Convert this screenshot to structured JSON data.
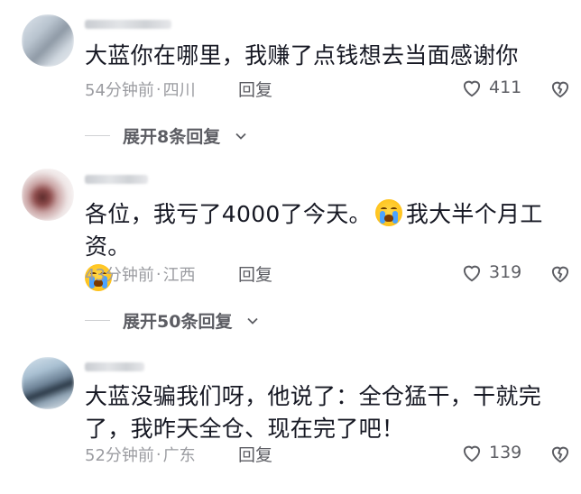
{
  "comments": [
    {
      "username": "•••••",
      "text": "大蓝你在哪里，我赚了点钱想去当面感谢你",
      "time": "54分钟前",
      "location": "四川",
      "reply_label": "回复",
      "likes": "411",
      "expand": "展开8条回复"
    },
    {
      "username": "•••••",
      "text_part1": "各位，我亏了4000了今天。",
      "text_part2": "我大半个月工资。",
      "time": "43分钟前",
      "location": "江西",
      "reply_label": "回复",
      "likes": "319",
      "expand": "展开50条回复"
    },
    {
      "username": "•••••",
      "text": "大蓝没骗我们呀，他说了：全仓猛干，干就完了，我昨天全仓、现在完了吧！",
      "time": "52分钟前",
      "location": "广东",
      "reply_label": "回复",
      "likes": "139"
    }
  ],
  "icons": {
    "like": "heart-outline-icon",
    "dislike": "broken-heart-icon",
    "expand": "chevron-down-icon",
    "emoji": "crying-face-emoji"
  },
  "colors": {
    "text": "#161823",
    "meta": "#9b9ca1",
    "action": "#5c5d63"
  },
  "separator": "·"
}
